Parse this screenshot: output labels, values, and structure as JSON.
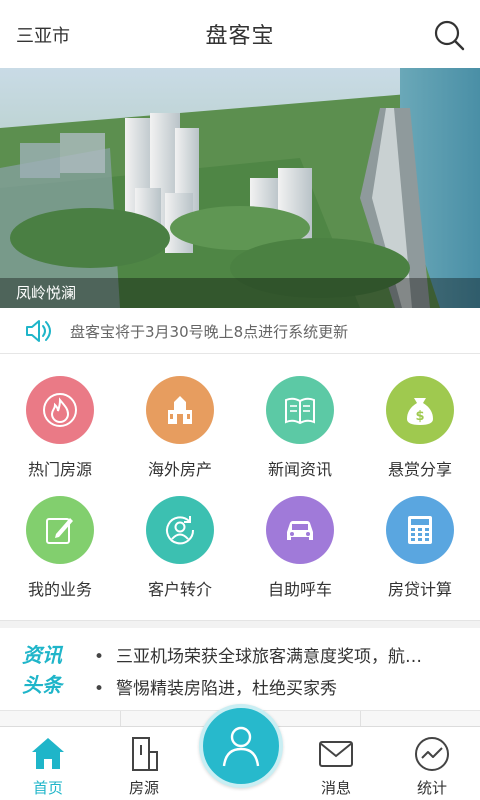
{
  "header": {
    "city": "三亚市",
    "title": "盘客宝"
  },
  "banner": {
    "caption": "凤岭悦澜"
  },
  "notice": {
    "text": "盘客宝将于3月30号晚上8点进行系统更新"
  },
  "grid": {
    "items": [
      {
        "label": "热门房源",
        "icon": "flame-icon",
        "color": "#ea7a86"
      },
      {
        "label": "海外房产",
        "icon": "building-icon",
        "color": "#e79d5f"
      },
      {
        "label": "新闻资讯",
        "icon": "newspaper-icon",
        "color": "#5cc9a5"
      },
      {
        "label": "悬赏分享",
        "icon": "money-bag-icon",
        "color": "#9fc94f"
      },
      {
        "label": "我的业务",
        "icon": "edit-icon",
        "color": "#82cf6e"
      },
      {
        "label": "客户转介",
        "icon": "client-refer-icon",
        "color": "#3cc0b1"
      },
      {
        "label": "自助呼车",
        "icon": "car-icon",
        "color": "#a07ad9"
      },
      {
        "label": "房贷计算",
        "icon": "calculator-icon",
        "color": "#5aa6e0"
      }
    ]
  },
  "news": {
    "badge_line1": "资讯",
    "badge_line2": "头条",
    "items": [
      "三亚机场荣获全球旅客满意度奖项，航…",
      "警惕精装房陷进，杜绝买家秀"
    ]
  },
  "tabbar": {
    "tabs": [
      {
        "label": "首页",
        "icon": "home-icon"
      },
      {
        "label": "房源",
        "icon": "house-listing-icon"
      },
      {
        "label": "消息",
        "icon": "mail-icon"
      },
      {
        "label": "统计",
        "icon": "chart-icon"
      }
    ],
    "center_icon": "user-icon"
  },
  "colors": {
    "accent": "#1fb5c9",
    "center_button": "#27b9cc"
  }
}
